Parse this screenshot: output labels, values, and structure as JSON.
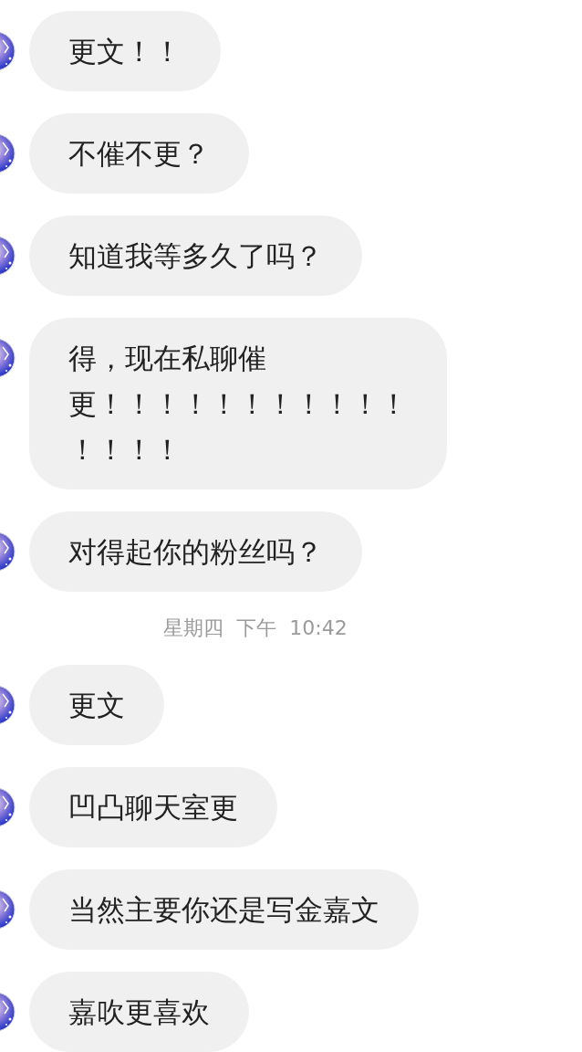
{
  "items": [
    {
      "kind": "message",
      "lines": [
        "更文！！"
      ]
    },
    {
      "kind": "message",
      "lines": [
        "不催不更？"
      ]
    },
    {
      "kind": "message",
      "lines": [
        "知道我等多久了吗？"
      ]
    },
    {
      "kind": "message",
      "lines": [
        "得，现在私聊催",
        "更！！！！！！！！！！！",
        "！！！！"
      ]
    },
    {
      "kind": "message",
      "lines": [
        "对得起你的粉丝吗？"
      ]
    },
    {
      "kind": "timestamp",
      "text": "星期四  下午  10:42"
    },
    {
      "kind": "message",
      "lines": [
        "更文"
      ]
    },
    {
      "kind": "message",
      "lines": [
        "凹凸聊天室更"
      ]
    },
    {
      "kind": "message",
      "lines": [
        "当然主要你还是写金嘉文"
      ]
    },
    {
      "kind": "message",
      "lines": [
        "嘉吹更喜欢"
      ]
    }
  ]
}
